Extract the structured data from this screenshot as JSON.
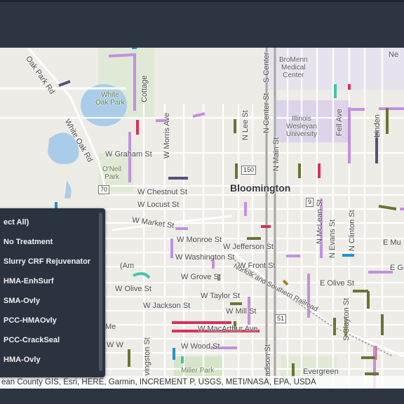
{
  "legend": {
    "select_all": "ect All)",
    "items": [
      "No Treatment",
      "Slurry CRF Rejuvenator",
      "HMA-EnhSurf",
      "SMA-Ovly",
      "PCC-HMAOvly",
      "PCC-CrackSeal",
      "HMA-Ovly"
    ]
  },
  "attribution": "ean County GIS, Esri, HERE, Garmin, INCREMENT P, USGS, METI/NASA, EPA, USDA",
  "map_labels": {
    "city": "Bloomington",
    "bromenn": [
      "BroMenn",
      "Medical",
      "Center"
    ],
    "iwu": [
      "Illinois",
      "Wesleyan",
      "University"
    ],
    "white_oak_park": [
      "White",
      "Oak Park"
    ],
    "oneil_park": [
      "O'Neil",
      "Park"
    ],
    "miller_park": "Miller Park",
    "evergreen": "Evergreen",
    "streets": {
      "oak_park_rd": "Oak Park Rd",
      "white_oak_rd": "White Oak Rd",
      "cottage": "Cottage",
      "w_morris_ave": "W Morris Ave",
      "w_graham_st": "W Graham St",
      "w_chestnut_st": "W Chestnut St",
      "w_locust_st": "W Locust St",
      "w_market_st": "W Market St",
      "w_monroe_st": "W Monroe St",
      "w_washington_st": "W Washington St",
      "w_jefferson_st": "W Jefferson St",
      "w_front_st": "W Front St",
      "w_grove_st": "W Grove St",
      "w_olive_st": "W Olive St",
      "w_taylor_st": "W Taylor St",
      "w_jackson_st": "W Jackson St",
      "w_mill_st": "W Mill St",
      "w_mcarthur_ave": "W MacArthur Ave",
      "w_wood_st": "W Wood St",
      "n_lee_st": "N Lee St",
      "n_center_st": "N Center St",
      "s_center": "S Center",
      "n_main_st": "N Main St",
      "fell_ave": "Fell Ave",
      "n_evans_st": "N Evans St",
      "n_clinton_st": "N Clinton St",
      "e_olive_st": "E Olive St",
      "s_clayton_st": "S Clayton St",
      "madison_st": "Madison St",
      "lvingston_st": "ivingston St",
      "norfolk": "Norfolk and Southern Railroad",
      "linden": "Linden",
      "n_mcleanst": "N McLean St",
      "w_olive_lbl": "W Olive St"
    },
    "shields": [
      "150",
      "70",
      "9",
      "51"
    ],
    "fragments": {
      "amb": "(Am",
      "e_mu": "E Mu",
      "ne": "Ne",
      "e_gr": "E Gr",
      "w_wo": "W W",
      "rd": "d",
      "me": "Me"
    }
  },
  "colors": {
    "no_treatment": "#6b7431",
    "slurry": "#c28fe3",
    "hma_enhsurf": "#d6325a",
    "sma_ovly": "#3ec7a7",
    "pcc_hmaovly": "#1f93d6",
    "pcc_crackseal": "#5a4e7c",
    "hma_ovly": "#b07a2f"
  }
}
